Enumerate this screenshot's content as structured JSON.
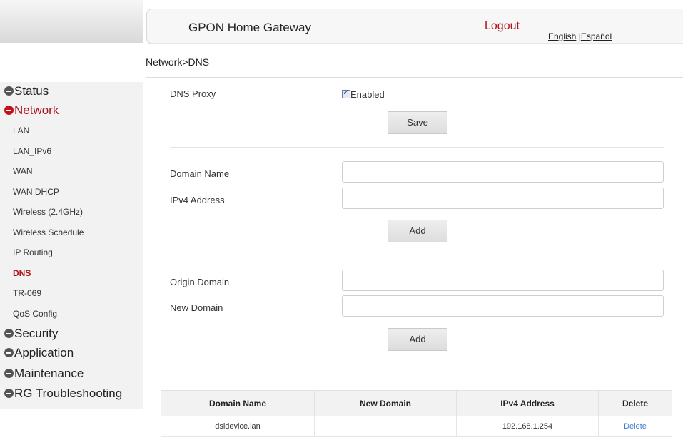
{
  "header": {
    "title": "GPON Home Gateway",
    "logout": "Logout",
    "lang_english": "English",
    "lang_sep": " |",
    "lang_espanol": "Español"
  },
  "breadcrumb": "Network>DNS",
  "sidebar": {
    "status": "Status",
    "network": "Network",
    "network_items": [
      "LAN",
      "LAN_IPv6",
      "WAN",
      "WAN DHCP",
      "Wireless (2.4GHz)",
      "Wireless Schedule",
      "IP Routing",
      "DNS",
      "TR-069",
      "QoS Config"
    ],
    "security": "Security",
    "application": "Application",
    "maintenance": "Maintenance",
    "troubleshooting": "RG Troubleshooting"
  },
  "dns_proxy": {
    "label": "DNS Proxy",
    "checkbox_label": "Enabled",
    "checked": true,
    "save": "Save"
  },
  "host_form": {
    "domain_label": "Domain Name",
    "domain_value": "",
    "ipv4_label": "IPv4 Address",
    "ipv4_value": "",
    "add": "Add"
  },
  "alias_form": {
    "origin_label": "Origin Domain",
    "origin_value": "",
    "new_label": "New Domain",
    "new_value": "",
    "add": "Add"
  },
  "table": {
    "headers": [
      "Domain Name",
      "New Domain",
      "IPv4 Address",
      "Delete"
    ],
    "rows": [
      {
        "domain": "dsldevice.lan",
        "new_domain": "",
        "ipv4": "192.168.1.254",
        "delete": "Delete"
      }
    ]
  },
  "colors": {
    "accent": "#b0121b",
    "link": "#3b7fd4"
  }
}
